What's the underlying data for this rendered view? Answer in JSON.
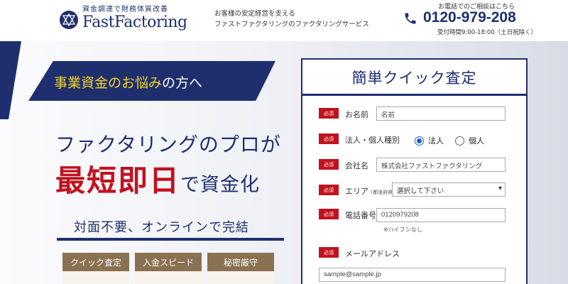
{
  "header": {
    "tagline": "資金調達で財務体質改善",
    "brand": "FastFactoring",
    "desc_line1": "お客様の安定経営を支える",
    "desc_line2": "ファストファクタリングのファクタリングサービス",
    "phone_label": "お電話でのご相談はこちら",
    "phone_number": "0120-979-208",
    "phone_hours": "受付時間9:00-18:00（土日祝除く）"
  },
  "hero": {
    "banner_yellow": "事業資金のお悩み",
    "banner_white": "の方へ",
    "heading_line1": "ファクタリングのプロが",
    "heading_red": "最短即日",
    "heading_blue": "で資金化",
    "sub": "対面不要、オンラインで完結",
    "badges": [
      {
        "label": "クイック査定",
        "value": "…"
      },
      {
        "label": "入金スピード",
        "value": "…"
      },
      {
        "label": "秘密厳守",
        "value": "…"
      }
    ]
  },
  "form": {
    "title": "簡単クイック査定",
    "required": "必須",
    "name_label": "お名前",
    "name_placeholder": "名前",
    "type_label": "法人・個人種別",
    "type_corp": "法人",
    "type_indiv": "個人",
    "company_label": "会社名",
    "company_placeholder": "株式会社ファストファクタリング",
    "area_label": "エリア",
    "area_note": "(都道府県)",
    "area_selected": "選択して下さい",
    "phone_label": "電話番号",
    "phone_placeholder": "0120979208",
    "phone_hint": "※ハイフンなし",
    "email_label": "メールアドレス",
    "email_placeholder": "sample@sample.jp"
  },
  "colors": {
    "brand_navy": "#1f2f6e",
    "accent_red": "#c1121f",
    "accent_yellow": "#f3d22c",
    "badge_gold": "#8a7152"
  }
}
